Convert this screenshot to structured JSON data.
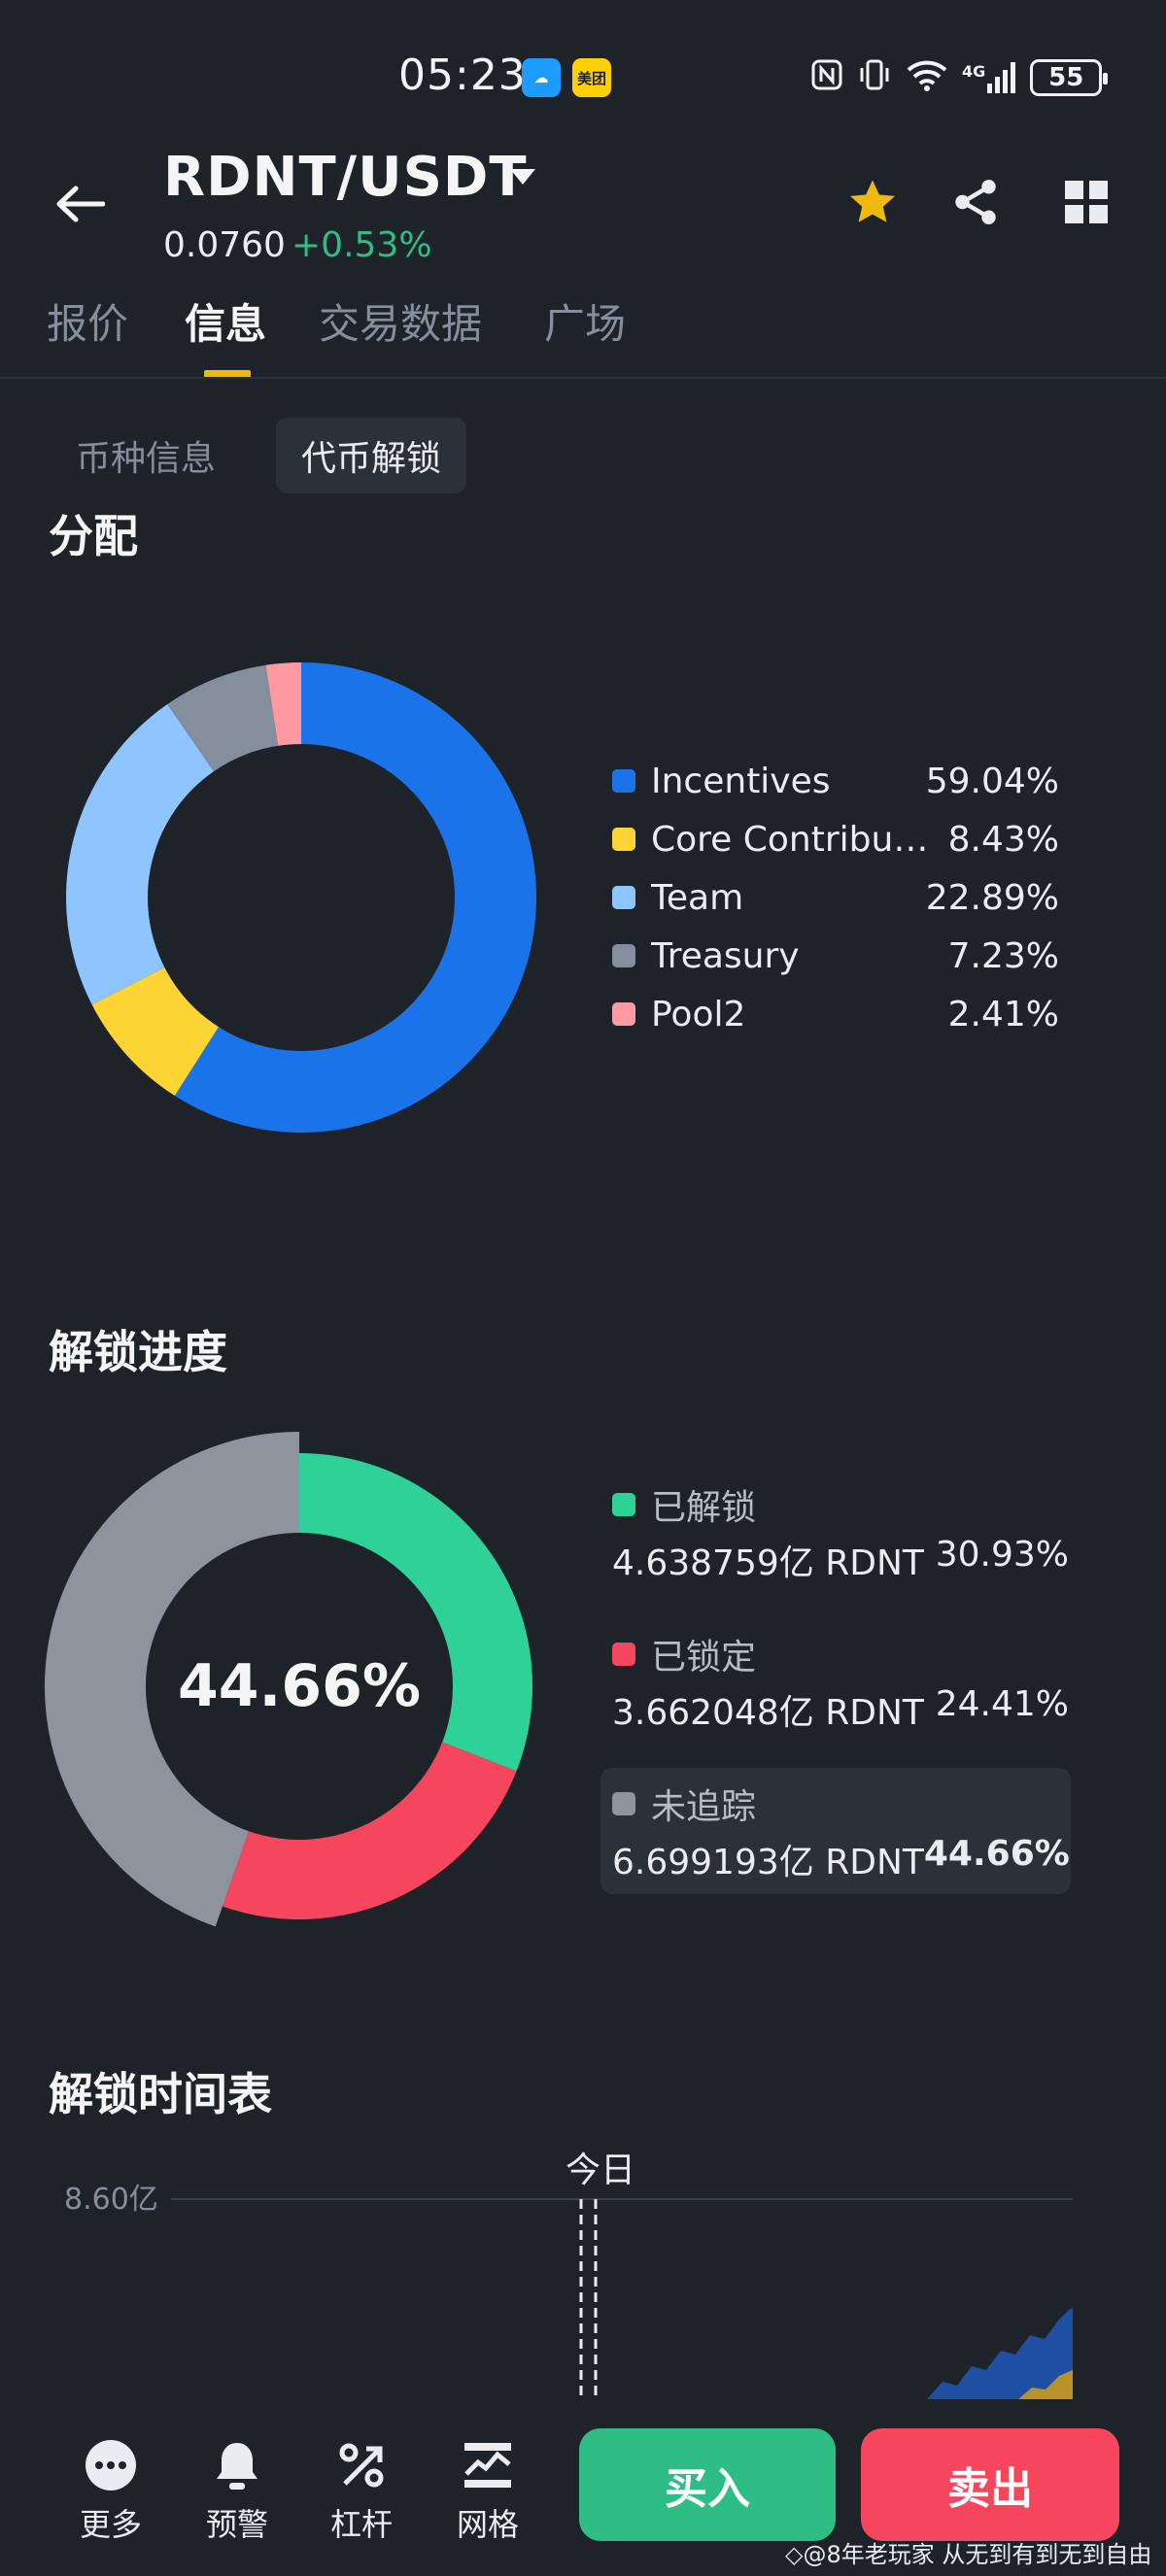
{
  "status_bar": {
    "time": "05:23",
    "app_badge_cloud": "☁",
    "app_badge_meituan": "美团",
    "network": "4G",
    "battery": "55"
  },
  "header": {
    "pair": "RDNT/USDT",
    "price": "0.0760",
    "change": "+0.53%",
    "colors": {
      "up": "#2ebd85",
      "down": "#f6465d",
      "accent": "#f0b90b"
    },
    "icons": [
      "back-arrow-icon",
      "caret-down-icon",
      "star-icon",
      "share-icon",
      "grid-icon"
    ]
  },
  "tabs": [
    {
      "label": "报价"
    },
    {
      "label": "信息"
    },
    {
      "label": "交易数据"
    },
    {
      "label": "广场"
    }
  ],
  "subtabs": [
    {
      "label": "币种信息"
    },
    {
      "label": "代币解锁"
    }
  ],
  "allocation": {
    "title": "分配",
    "items": [
      {
        "name": "Incentives",
        "pct": "59.04%",
        "value": 59.04,
        "color": "#1a73e8"
      },
      {
        "name": "Core Contributors",
        "pct": "8.43%",
        "value": 8.43,
        "color": "#fcd535"
      },
      {
        "name": "Team",
        "pct": "22.89%",
        "value": 22.89,
        "color": "#8ec5ff"
      },
      {
        "name": "Treasury",
        "pct": "7.23%",
        "value": 7.23,
        "color": "#848e9c"
      },
      {
        "name": "Pool2",
        "pct": "2.41%",
        "value": 2.41,
        "color": "#ff9aa2"
      }
    ]
  },
  "unlock_progress": {
    "title": "解锁进度",
    "center": "44.66%",
    "items": [
      {
        "label": "已解锁",
        "amount": "4.638759亿 RDNT",
        "pct": "30.93%",
        "value": 30.93,
        "color": "#2ed198"
      },
      {
        "label": "已锁定",
        "amount": "3.662048亿 RDNT",
        "pct": "24.41%",
        "value": 24.41,
        "color": "#f6465d"
      },
      {
        "label": "未追踪",
        "amount": "6.699193亿 RDNT",
        "pct": "44.66%",
        "value": 44.66,
        "color": "#8e949e"
      }
    ]
  },
  "schedule": {
    "title": "解锁时间表",
    "y_label": "8.60亿",
    "today": "今日"
  },
  "bottom_nav": [
    {
      "label": "更多"
    },
    {
      "label": "预警"
    },
    {
      "label": "杠杆"
    },
    {
      "label": "网格"
    }
  ],
  "buy": "买入",
  "sell": "卖出",
  "watermark": "◇@8年老玩家 从无到有到无到自由"
}
